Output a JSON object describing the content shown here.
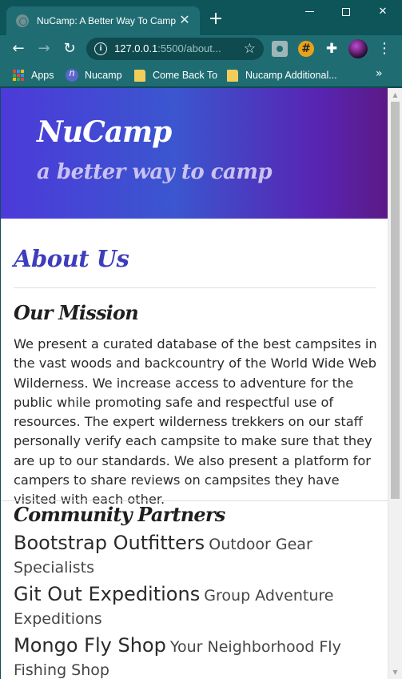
{
  "browser": {
    "tab_title": "NuCamp: A Better Way To Camp",
    "url_host": "127.0.0.1",
    "url_rest": ":5500/about...",
    "bookmarks": [
      "Apps",
      "Nucamp",
      "Come Back To",
      "Nucamp Additional..."
    ],
    "icons": {
      "tab_favicon": "globe-icon",
      "close": "close-icon",
      "new_tab": "plus-icon",
      "back": "arrow-left-icon",
      "forward": "arrow-right-icon",
      "reload": "reload-icon",
      "info": "info-icon",
      "star": "star-icon",
      "extensions": [
        "camera-icon",
        "grid-badge-icon",
        "puzzle-icon",
        "profile-avatar-icon"
      ],
      "menu": "kebab-menu-icon",
      "bookmarks_more": "chevron-double-right-icon"
    },
    "colors": {
      "frame": "#0d5559",
      "toolbar": "#1f6d73"
    }
  },
  "page": {
    "brand": "NuCamp",
    "tagline": "a better way to camp",
    "about_heading": "About Us",
    "mission_heading": "Our Mission",
    "mission_text": "We present a curated database of the best campsites in the vast woods and backcountry of the World Wide Web Wilderness. We increase access to adventure for the public while promoting safe and respectful use of resources. The expert wilderness trekkers on our staff personally verify each campsite to make sure that they are up to our standards. We also present a platform for campers to share reviews on campsites they have visited with each other.",
    "partners_heading": "Community Partners",
    "partners": [
      {
        "name": "Bootstrap Outfitters",
        "description": "Outdoor Gear Specialists"
      },
      {
        "name": "Git Out Expeditions",
        "description": "Group Adventure Expeditions"
      },
      {
        "name": "Mongo Fly Shop",
        "description": "Your Neighborhood Fly Fishing Shop"
      }
    ],
    "colors": {
      "jumbotron_start": "#4c3ad9",
      "jumbotron_end": "#5c1a86",
      "heading_accent": "#3d3dbd"
    }
  }
}
